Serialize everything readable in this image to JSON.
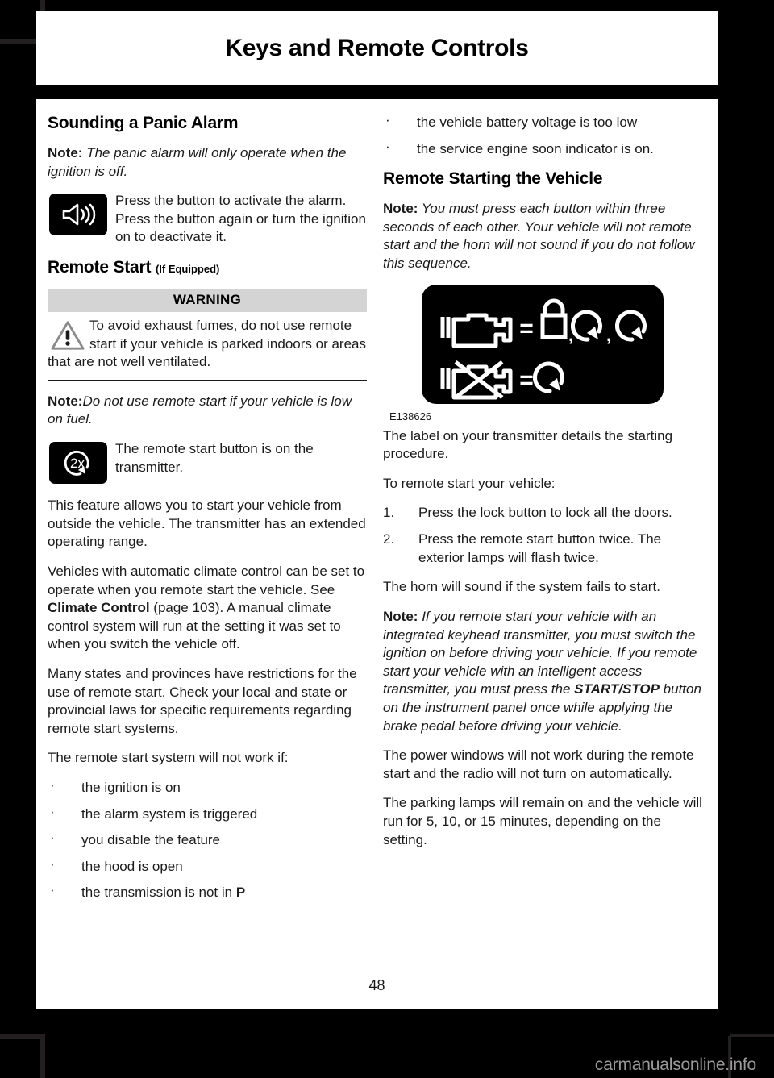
{
  "header": {
    "title": "Keys and Remote Controls"
  },
  "footer": {
    "page_number": "48",
    "watermark": "carmanualsonline.info"
  },
  "left_column": {
    "heading_panic": "Sounding a Panic Alarm",
    "note_panic_label": "Note:",
    "note_panic_text": "The panic alarm will only operate when the ignition is off.",
    "speaker_icon_text": "Press the button to activate the alarm. Press the button again or turn the ignition on to deactivate it.",
    "heading_remote_start": "Remote Start",
    "heading_remote_start_qualifier": "(If Equipped)",
    "warning_label": "WARNING",
    "warning_text": "To avoid exhaust fumes, do not use remote start if your vehicle is parked indoors or areas that are not well ventilated.",
    "note_fuel_label": "Note:",
    "note_fuel_text": "Do not use remote start if your vehicle is low on fuel.",
    "twox_icon_text": "The remote start button is on the transmitter.",
    "para_feature": "This feature allows you to start your vehicle from outside the vehicle. The transmitter has an extended operating range.",
    "para_climate_a": "Vehicles with automatic climate control can be set to operate when you remote start the vehicle.  See ",
    "para_climate_link": "Climate Control",
    "para_climate_b": " (page 103).  A manual climate control system will run at the setting it was set to when you switch the vehicle off.",
    "para_laws": "Many states and provinces have restrictions for the use of remote start. Check your local and state or provincial laws for specific requirements regarding remote start systems.",
    "para_notwork_intro": "The remote start system will not work if:",
    "notwork_bullets": [
      {
        "text": "the ignition is on"
      },
      {
        "text": "the alarm system is triggered"
      },
      {
        "text": "you disable the feature"
      },
      {
        "text": "the hood is open"
      },
      {
        "text": "the transmission is not in ",
        "bold_suffix": "P"
      }
    ]
  },
  "right_column": {
    "notwork_bullets_cont": [
      "the vehicle battery voltage is too low",
      "the service engine soon indicator is on."
    ],
    "heading_remote_starting": "Remote Starting the Vehicle",
    "note_sequence_label": "Note:",
    "note_sequence_text": "You must press each button within three seconds of each other. Your vehicle will not remote start and the horn will not sound if you do not follow this sequence.",
    "figure_caption": "E138626",
    "figure_rows": [
      {
        "left_icon": "engine-icon",
        "equals": "=",
        "right_icons": [
          "lock-icon",
          "circular-arrow-icon",
          "circular-arrow-icon"
        ],
        "separators": [
          ",",
          ","
        ]
      },
      {
        "left_icon": "engine-crossed-out-icon",
        "equals": "=",
        "right_icons": [
          "circular-arrow-icon"
        ],
        "separators": []
      }
    ],
    "para_label": "The label on your transmitter details the starting procedure.",
    "para_to_remote_start": "To remote start your vehicle:",
    "steps": [
      {
        "num": "1.",
        "text": "Press the lock button to lock all the doors."
      },
      {
        "num": "2.",
        "text": "Press the remote start button twice. The exterior lamps will flash twice."
      }
    ],
    "para_horn": "The horn will sound if the system fails to start.",
    "note_transmitter_label": "Note:",
    "note_transmitter_a": "If you remote start your vehicle with an integrated keyhead transmitter, you must switch the ignition on before driving your vehicle. If you remote start your vehicle with an intelligent access transmitter, you must press the ",
    "note_transmitter_bold": "START/STOP",
    "note_transmitter_b": " button on the instrument panel once while applying the brake pedal before driving your vehicle.",
    "para_windows": "The power windows will not work during the remote start and the radio will not turn on automatically.",
    "para_lamps": "The parking lamps will remain on and the vehicle will run for 5, 10, or 15 minutes, depending on the setting."
  },
  "colors": {
    "page_background": "#ffffff",
    "outer_background": "#000000",
    "warning_header_bg": "#d4d4d4",
    "text": "#1a1a1a",
    "crop_mark": "#231f20",
    "watermark": "#9a9a9a"
  }
}
